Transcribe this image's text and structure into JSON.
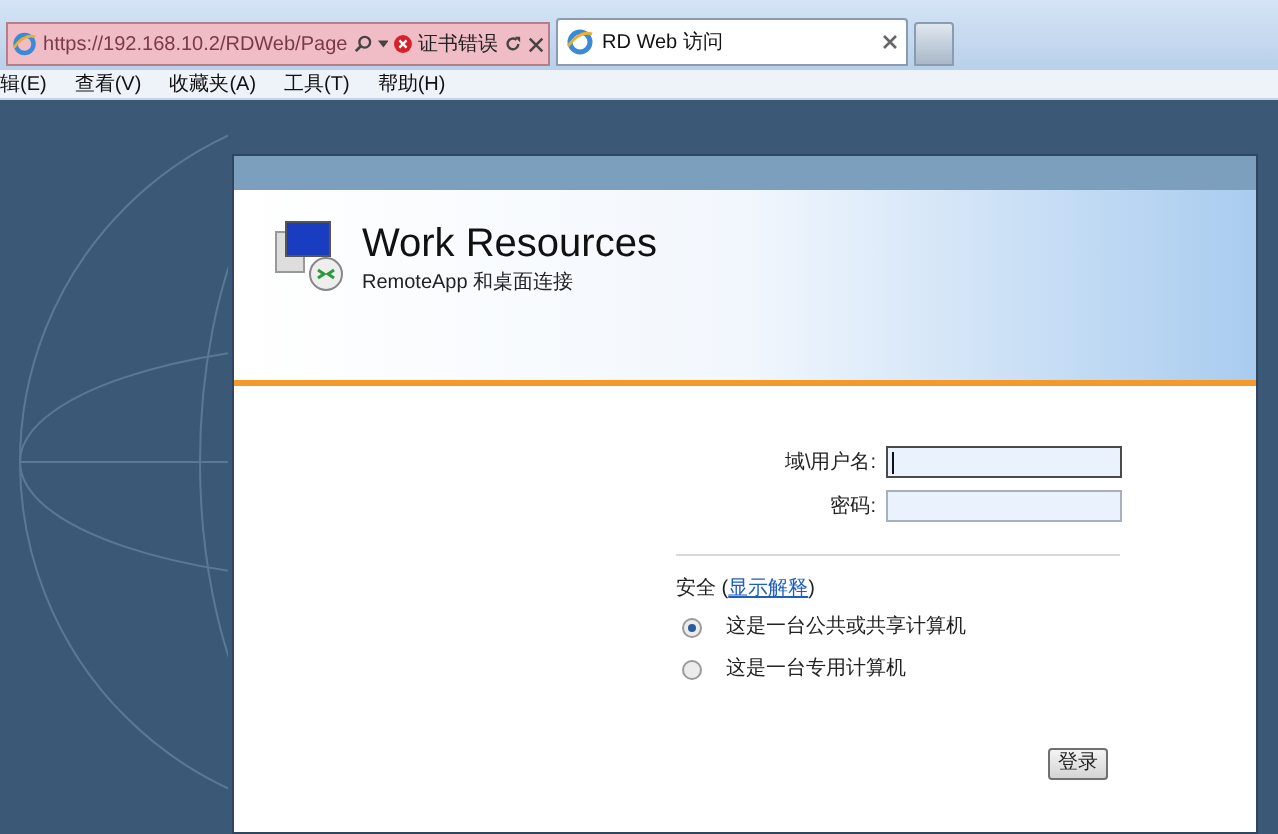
{
  "browser": {
    "address_bar": {
      "url": "https://192.168.10.2/RDWeb/Page",
      "certificate_error": "证书错误"
    },
    "tabs": [
      {
        "label": "RD Web 访问",
        "selected": true
      }
    ],
    "menu": [
      "辑(E)",
      "查看(V)",
      "收藏夹(A)",
      "工具(T)",
      "帮助(H)"
    ]
  },
  "header": {
    "title": "Work Resources",
    "subtitle": "RemoteApp 和桌面连接"
  },
  "form": {
    "fields": [
      {
        "label": "域\\用户名:",
        "focused": true
      },
      {
        "label": "密码:",
        "focused": false
      }
    ],
    "security": {
      "before": "安全 (",
      "link": "显示解释",
      "after": ")"
    },
    "options": [
      {
        "label": "这是一台公共或共享计算机",
        "selected": true
      },
      {
        "label": "这是一台专用计算机",
        "selected": false
      }
    ],
    "submit": "登录"
  }
}
